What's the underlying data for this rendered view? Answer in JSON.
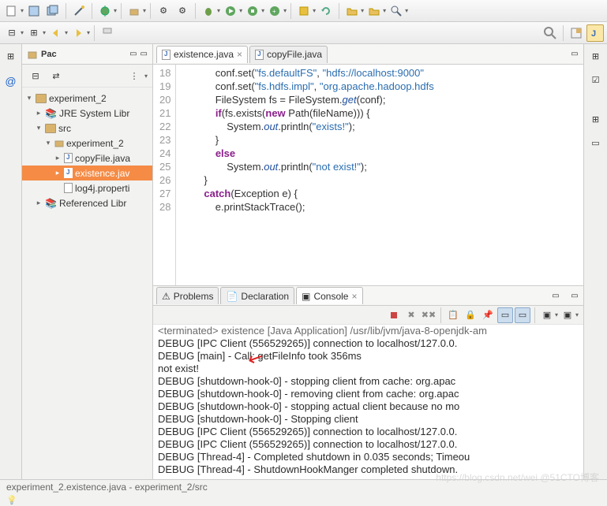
{
  "tree": {
    "project": "experiment_2",
    "jre": "JRE System Libr",
    "src": "src",
    "pkg": "experiment_2",
    "file1": "copyFile.java",
    "file2": "existence.jav",
    "file3": "log4j.properti",
    "refs": "Referenced Libr"
  },
  "pac_label": "Pac",
  "editor_tabs": {
    "t1": "existence.java",
    "t2": "copyFile.java"
  },
  "gutter": [
    "18",
    "19",
    "20",
    "21",
    "22",
    "23",
    "24",
    "25",
    "26",
    "27",
    "28"
  ],
  "code_lines": {
    "l18_a": "            conf.set(",
    "l18_s1": "\"fs.defaultFS\"",
    "l18_b": ", ",
    "l18_s2": "\"hdfs://localhost:9000\"",
    "l19_a": "            conf.set(",
    "l19_s1": "\"fs.hdfs.impl\"",
    "l19_b": ", ",
    "l19_s2": "\"org.apache.hadoop.hdfs",
    "l20_a": "            FileSystem fs = FileSystem.",
    "l20_m": "get",
    "l20_b": "(conf);",
    "l21_a": "            ",
    "l21_if": "if",
    "l21_b": "(fs.exists(",
    "l21_new": "new",
    "l21_c": " Path(fileName))) {",
    "l22_a": "                System.",
    "l22_out": "out",
    "l22_b": ".println(",
    "l22_s": "\"exists!\"",
    "l22_c": ");",
    "l23": "            }",
    "l24_a": "            ",
    "l24_else": "else",
    "l25_a": "                System.",
    "l25_out": "out",
    "l25_b": ".println(",
    "l25_s": "\"not exist!\"",
    "l25_c": ");",
    "l26": "        }",
    "l27_a": "        ",
    "l27_catch": "catch",
    "l27_b": "(Exception e) {",
    "l28": "            e.printStackTrace();"
  },
  "bottom_tabs": {
    "problems": "Problems",
    "declaration": "Declaration",
    "console": "Console"
  },
  "console_header": "<terminated> existence [Java Application] /usr/lib/jvm/java-8-openjdk-am",
  "console_lines": [
    "DEBUG [IPC Client (556529265)] connection to localhost/127.0.0.",
    "DEBUG [main] - Call: getFileInfo took 356ms",
    "not exist!",
    "DEBUG [shutdown-hook-0] - stopping client from cache: org.apac",
    "DEBUG [shutdown-hook-0] - removing client from cache: org.apac",
    "DEBUG [shutdown-hook-0] - stopping actual client because no mo",
    "DEBUG [shutdown-hook-0] - Stopping client",
    "DEBUG [IPC Client (556529265)] connection to localhost/127.0.0.",
    "DEBUG [IPC Client (556529265)] connection to localhost/127.0.0.",
    "DEBUG [Thread-4] - Completed shutdown in 0.035 seconds; Timeou",
    "DEBUG [Thread-4] - ShutdownHookManger completed shutdown."
  ],
  "status_bar": "experiment_2.existence.java - experiment_2/src",
  "watermark": "https://blog.csdn.net/wei @51CTO博客"
}
